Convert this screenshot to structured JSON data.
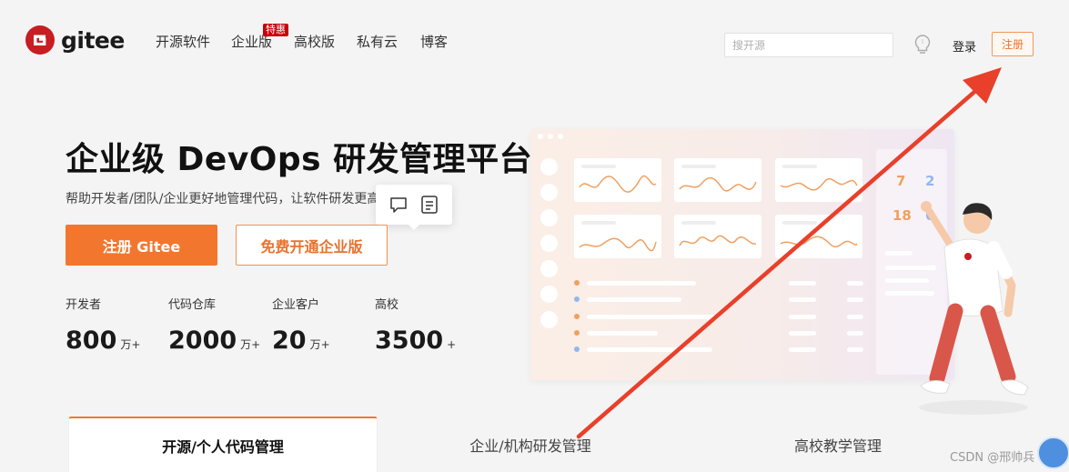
{
  "header": {
    "logo_text": "gitee",
    "nav": [
      {
        "label": "开源软件"
      },
      {
        "label": "企业版",
        "badge": "特惠"
      },
      {
        "label": "高校版"
      },
      {
        "label": "私有云"
      },
      {
        "label": "博客"
      }
    ],
    "search_placeholder": "搜开源",
    "login_label": "登录",
    "signup_label": "注册"
  },
  "hero": {
    "title": "企业级 DevOps 研发管理平台",
    "subtitle": "帮助开发者/团队/企业更好地管理代码，让软件研发更高效",
    "primary_cta": "注册 Gitee",
    "secondary_cta": "免费开通企业版",
    "stats": [
      {
        "label": "开发者",
        "value": "800",
        "unit": "万+"
      },
      {
        "label": "代码仓库",
        "value": "2000",
        "unit": "万+"
      },
      {
        "label": "企业客户",
        "value": "20",
        "unit": "万+"
      },
      {
        "label": "高校",
        "value": "3500",
        "unit": "+"
      }
    ]
  },
  "illustration": {
    "calendar_numbers": [
      "7",
      "2",
      "18",
      "6"
    ]
  },
  "tabs": [
    {
      "label": "开源/个人代码管理",
      "active": true
    },
    {
      "label": "企业/机构研发管理",
      "active": false
    },
    {
      "label": "高校教学管理",
      "active": false
    }
  ],
  "watermark": "CSDN @邢帅兵",
  "colors": {
    "brand_red": "#c71d23",
    "accent_orange": "#f3762f",
    "annotation_arrow": "#e8402a"
  },
  "icons": {
    "logo": "gitee-logo-icon",
    "bulb": "lightbulb-icon",
    "comment": "comment-icon",
    "note": "note-icon"
  }
}
